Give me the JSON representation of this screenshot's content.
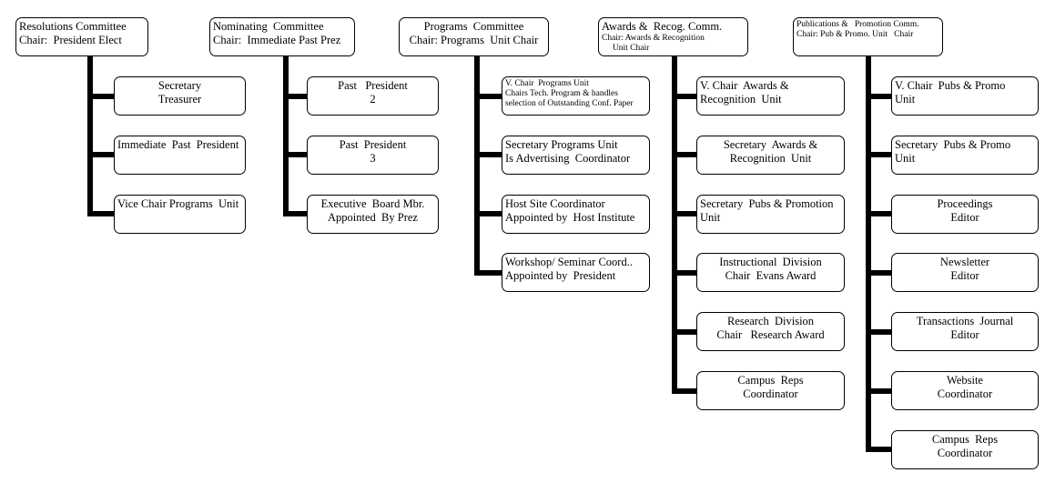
{
  "columns": [
    {
      "head": [
        "Resolutions Committee",
        "Chair:  President Elect"
      ],
      "children": [
        [
          "Secretary",
          "Treasurer"
        ],
        [
          "Immediate  Past  President"
        ],
        [
          "Vice Chair Programs  Unit"
        ]
      ]
    },
    {
      "head": [
        "Nominating  Committee",
        "Chair:  Immediate Past Prez"
      ],
      "children": [
        [
          "Past   President",
          "2"
        ],
        [
          "Past  President",
          "3"
        ],
        [
          "Executive  Board Mbr.",
          "Appointed  By Prez"
        ]
      ]
    },
    {
      "head": [
        "Programs  Committee",
        "Chair: Programs  Unit Chair"
      ],
      "children": [
        [
          "V. Chair  Programs Unit",
          "Chairs Tech. Program & handles",
          "selection of Outstanding Conf. Paper"
        ],
        [
          "Secretary Programs Unit",
          "Is Advertising  Coordinator"
        ],
        [
          "Host Site Coordinator",
          "Appointed by  Host Institute"
        ],
        [
          "Workshop/ Seminar Coord..",
          "Appointed by  President"
        ]
      ]
    },
    {
      "head": [
        "Awards &  Recog. Comm.",
        "Chair: Awards & Recognition",
        "     Unit Chair"
      ],
      "children": [
        [
          "V. Chair  Awards &",
          "Recognition  Unit"
        ],
        [
          "Secretary  Awards &",
          "Recognition  Unit"
        ],
        [
          "Secretary  Pubs & Promotion",
          "Unit"
        ],
        [
          "Instructional  Division",
          "Chair  Evans Award"
        ],
        [
          "Research  Division",
          "Chair   Research Award"
        ],
        [
          "Campus  Reps",
          "Coordinator"
        ]
      ]
    },
    {
      "head": [
        "Publications &   Promotion Comm.",
        "Chair: Pub & Promo. Unit   Chair"
      ],
      "children": [
        [
          "V. Chair  Pubs & Promo",
          "Unit"
        ],
        [
          "Secretary  Pubs & Promo",
          "Unit"
        ],
        [
          "Proceedings",
          "Editor"
        ],
        [
          "Newsletter",
          "Editor"
        ],
        [
          "Transactions  Journal",
          "Editor"
        ],
        [
          "Website",
          "Coordinator"
        ],
        [
          "Campus  Reps",
          "Coordinator"
        ]
      ]
    }
  ]
}
